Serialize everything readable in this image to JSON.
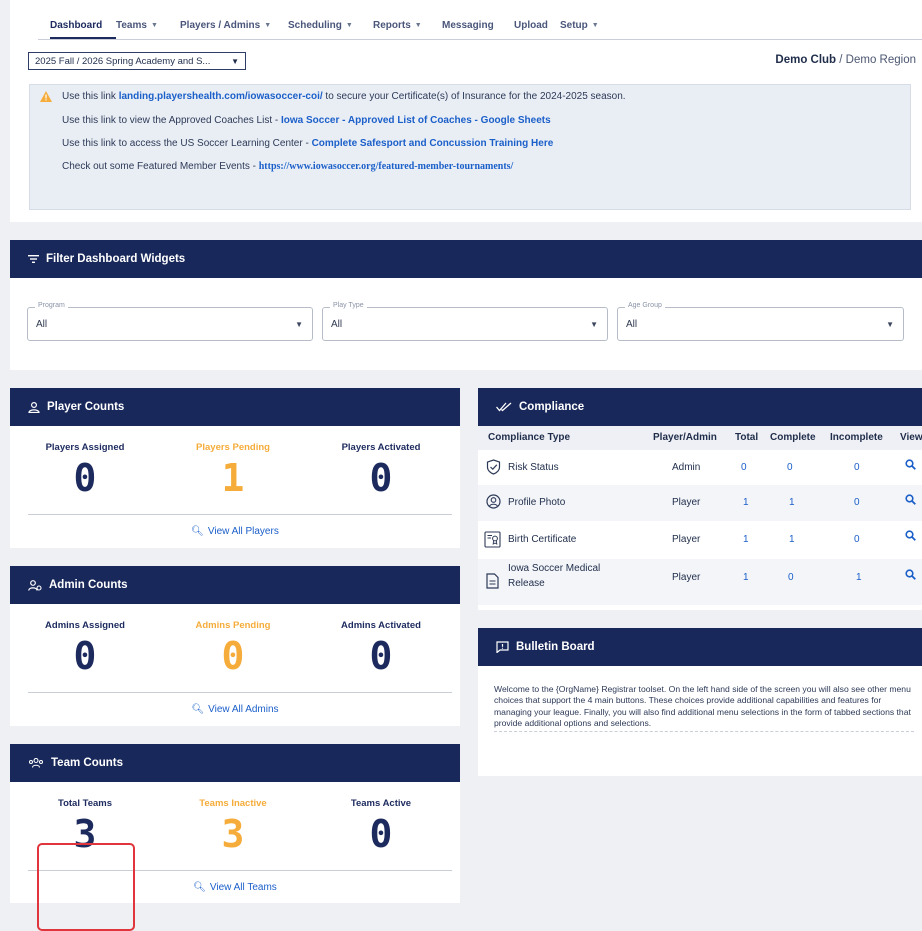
{
  "nav": {
    "items": [
      {
        "label": "Dashboard"
      },
      {
        "label": "Teams"
      },
      {
        "label": "Players / Admins"
      },
      {
        "label": "Scheduling"
      },
      {
        "label": "Reports"
      },
      {
        "label": "Messaging"
      },
      {
        "label": "Upload"
      },
      {
        "label": "Setup"
      }
    ]
  },
  "season_select": {
    "value": "2025 Fall / 2026 Spring Academy and S..."
  },
  "org": {
    "club": "Demo Club",
    "region": " / Demo Region"
  },
  "notice": {
    "l1_pre": "Use this link ",
    "l1_link": "landing.playershealth.com/iowasoccer-coi/",
    "l1_post": " to secure your Certificate(s) of Insurance for the 2024-2025 season.",
    "l2_pre": "Use this link to view the Approved Coaches List - ",
    "l2_link": "Iowa Soccer - Approved List of Coaches - Google Sheets",
    "l3_pre": "Use this link to access the US Soccer Learning Center - ",
    "l3_link": "Complete Safesport and Concussion Training Here",
    "l4_pre": "Check out some Featured Member Events - ",
    "l4_link": "https://www.iowasoccer.org/featured-member-tournaments/"
  },
  "filter": {
    "title": "Filter Dashboard Widgets",
    "program": {
      "legend": "Program",
      "value": "All"
    },
    "play_type": {
      "legend": "Play Type",
      "value": "All"
    },
    "age_group": {
      "legend": "Age Group",
      "value": "All"
    }
  },
  "player_counts": {
    "title": "Player Counts",
    "assigned_label": "Players Assigned",
    "assigned": "0",
    "pending_label": "Players Pending",
    "pending": "1",
    "activated_label": "Players Activated",
    "activated": "0",
    "link": "View All Players"
  },
  "admin_counts": {
    "title": "Admin Counts",
    "assigned_label": "Admins Assigned",
    "assigned": "0",
    "pending_label": "Admins Pending",
    "pending": "0",
    "activated_label": "Admins Activated",
    "activated": "0",
    "link": "View All Admins"
  },
  "team_counts": {
    "title": "Team Counts",
    "total_label": "Total Teams",
    "total": "3",
    "inactive_label": "Teams Inactive",
    "inactive": "3",
    "active_label": "Teams Active",
    "active": "0",
    "link": "View All Teams"
  },
  "compliance": {
    "title": "Compliance",
    "headers": {
      "type": "Compliance Type",
      "who": "Player/Admin",
      "total": "Total",
      "complete": "Complete",
      "incomplete": "Incomplete",
      "view": "View"
    },
    "rows": [
      {
        "name": "Risk Status",
        "who": "Admin",
        "total": "0",
        "complete": "0",
        "incomplete": "0",
        "icon": "shield-check-icon"
      },
      {
        "name": "Profile Photo",
        "who": "Player",
        "total": "1",
        "complete": "1",
        "incomplete": "0",
        "icon": "user-circle-icon"
      },
      {
        "name": "Birth Certificate",
        "who": "Player",
        "total": "1",
        "complete": "1",
        "incomplete": "0",
        "icon": "certificate-icon"
      },
      {
        "name": "Iowa Soccer Medical Release",
        "name_l1": "Iowa Soccer Medical",
        "name_l2": "Release",
        "who": "Player",
        "total": "1",
        "complete": "0",
        "incomplete": "1",
        "icon": "document-icon"
      }
    ]
  },
  "bulletin": {
    "title": "Bulletin Board",
    "text": "Welcome to the {OrgName} Registrar toolset. On the left hand side of the screen you will also see other menu choices that support the 4 main buttons. These choices provide additional capabilities and features for managing your league. Finally, you will also find additional menu selections in the form of tabbed sections that provide additional options and selections."
  },
  "colors": {
    "navy": "#19285a",
    "accent": "#1b5fc9",
    "pending": "#f5ac3a",
    "highlight": "#e0353d"
  }
}
